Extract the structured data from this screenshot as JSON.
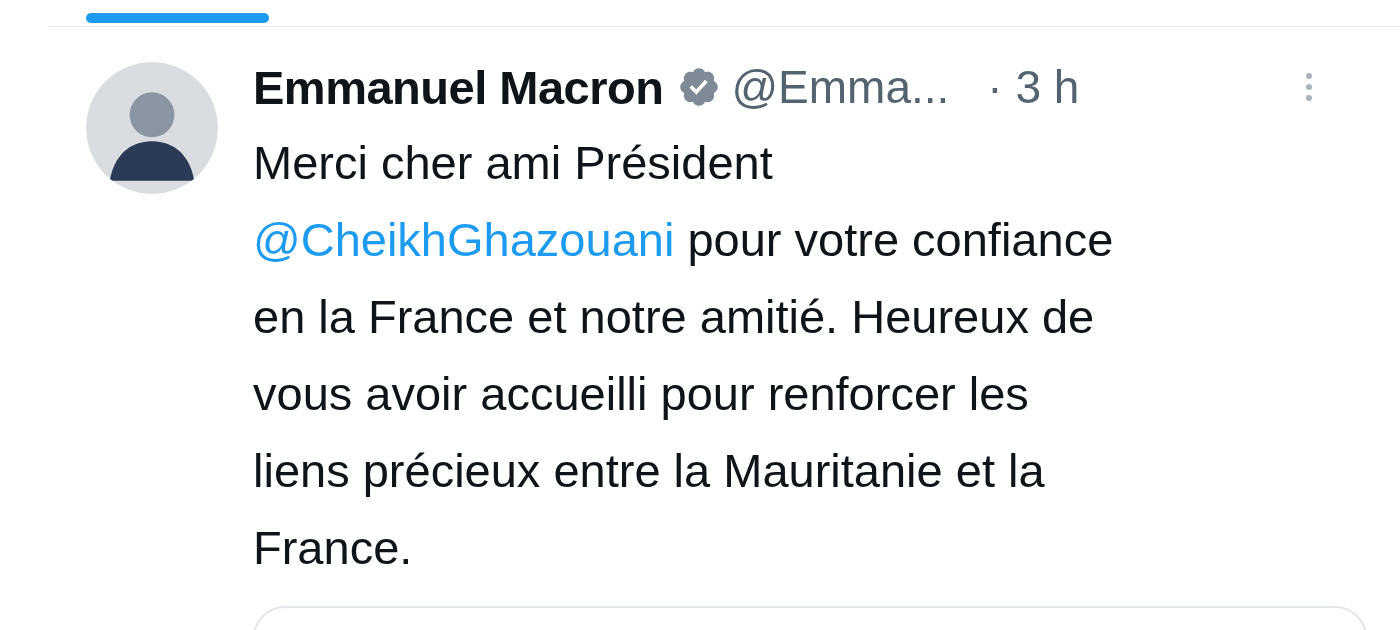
{
  "tab_indicator": {
    "selected": true
  },
  "tweet": {
    "author": "Emmanuel Macron",
    "verified": true,
    "handle": "@Emma...",
    "time": "· 3 h",
    "text": [
      {
        "kind": "plain",
        "text": "Merci cher ami Président\n"
      },
      {
        "kind": "mention",
        "text": "@CheikhGhazouani"
      },
      {
        "kind": "plain",
        "text": " pour votre confiance\nen la France et notre amitié. Heureux de\nvous avoir accueilli pour renforcer les\nliens précieux entre la Mauritanie et la\nFrance."
      }
    ]
  }
}
